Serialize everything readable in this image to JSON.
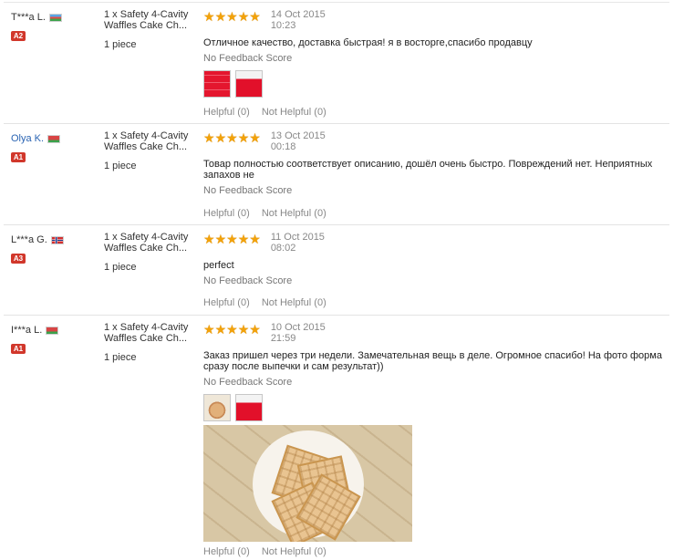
{
  "reviews": [
    {
      "user": "T***a L.",
      "user_is_link": false,
      "flag": "az",
      "level": "A2",
      "product": "1 x Safety 4-Cavity Waffles Cake Ch...",
      "quantity": "1 piece",
      "rating": 5,
      "date": "14 Oct 2015",
      "time": "10:23",
      "comment": "Отличное качество, доставка быстрая! я в восторге,спасибо продавцу",
      "feedback_score": "No Feedback Score",
      "photos": [
        "red-silicone-mold-photo",
        "red-silicone-mold-photo"
      ],
      "has_big_photo": false,
      "helpful": "Helpful (0)",
      "not_helpful": "Not Helpful (0)"
    },
    {
      "user": "Olya K.",
      "user_is_link": true,
      "flag": "by",
      "level": "A1",
      "product": "1 x Safety 4-Cavity Waffles Cake Ch...",
      "quantity": "1 piece",
      "rating": 5,
      "date": "13 Oct 2015",
      "time": "00:18",
      "comment": "Товар полностью соответствует описанию, дошёл очень быстро. Повреждений нет. Неприятных запахов не",
      "feedback_score": "No Feedback Score",
      "photos": [],
      "has_big_photo": false,
      "helpful": "Helpful (0)",
      "not_helpful": "Not Helpful (0)"
    },
    {
      "user": "L***a G.",
      "user_is_link": false,
      "flag": "no",
      "level": "A3",
      "product": "1 x Safety 4-Cavity Waffles Cake Ch...",
      "quantity": "1 piece",
      "rating": 5,
      "date": "11 Oct 2015",
      "time": "08:02",
      "comment": "perfect",
      "feedback_score": "No Feedback Score",
      "photos": [],
      "has_big_photo": false,
      "helpful": "Helpful (0)",
      "not_helpful": "Not Helpful (0)"
    },
    {
      "user": "I***a L.",
      "user_is_link": false,
      "flag": "by",
      "level": "A1",
      "product": "1 x Safety 4-Cavity Waffles Cake Ch...",
      "quantity": "1 piece",
      "rating": 5,
      "date": "10 Oct 2015",
      "time": "21:59",
      "comment": "Заказ пришел через три недели. Замечательная вещь в деле. Огромное спасибо! На фото форма сразу после выпечки и сам результат))",
      "feedback_score": "No Feedback Score",
      "photos": [
        "waffle-photo",
        "red-silicone-mold-photo"
      ],
      "has_big_photo": true,
      "helpful": "Helpful (0)",
      "not_helpful": "Not Helpful (0)"
    }
  ]
}
